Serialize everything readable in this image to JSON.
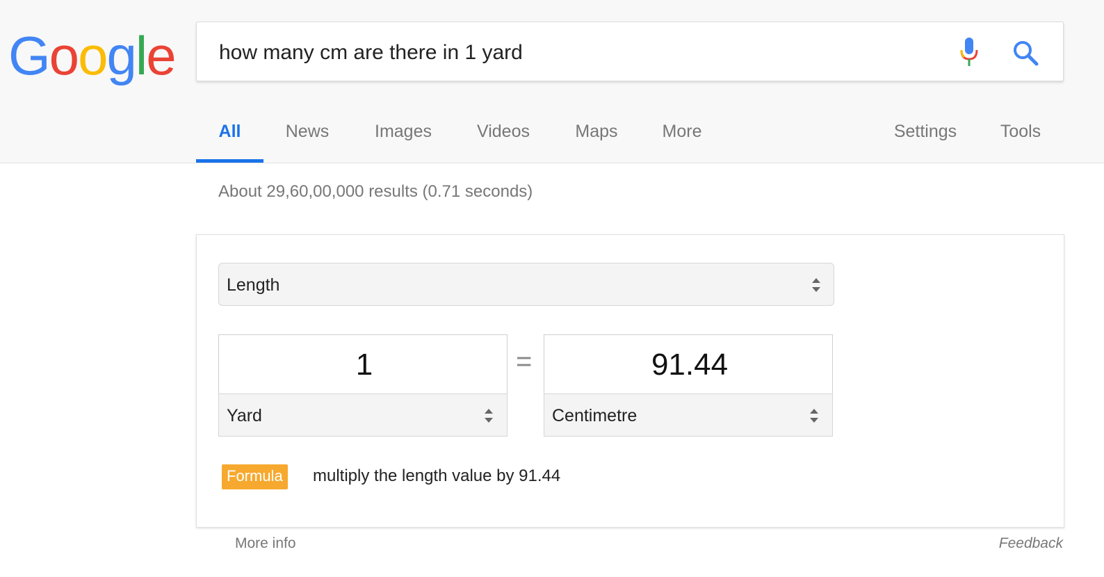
{
  "logo": {
    "letters": [
      "G",
      "o",
      "o",
      "g",
      "l",
      "e"
    ],
    "colors": [
      "#4285f4",
      "#ea4335",
      "#fbbc05",
      "#4285f4",
      "#34a853",
      "#ea4335"
    ]
  },
  "search": {
    "query": "how many cm are there in 1 yard",
    "mic_icon": "microphone-icon",
    "search_icon": "magnifier-icon"
  },
  "tabs": [
    {
      "label": "All",
      "active": true
    },
    {
      "label": "News"
    },
    {
      "label": "Images"
    },
    {
      "label": "Videos"
    },
    {
      "label": "Maps"
    },
    {
      "label": "More"
    },
    {
      "label": "Settings"
    },
    {
      "label": "Tools"
    }
  ],
  "result_stats": "About 29,60,00,000 results (0.71 seconds)",
  "converter": {
    "category": "Length",
    "equals_sign": "=",
    "from": {
      "value": "1",
      "unit": "Yard"
    },
    "to": {
      "value": "91.44",
      "unit": "Centimetre"
    },
    "formula_badge": "Formula",
    "formula_text": "multiply the length value by 91.44"
  },
  "footer": {
    "more_info": "More info",
    "feedback": "Feedback"
  },
  "colors": {
    "accent": "#1a73e8",
    "badge": "#f6a92e"
  }
}
